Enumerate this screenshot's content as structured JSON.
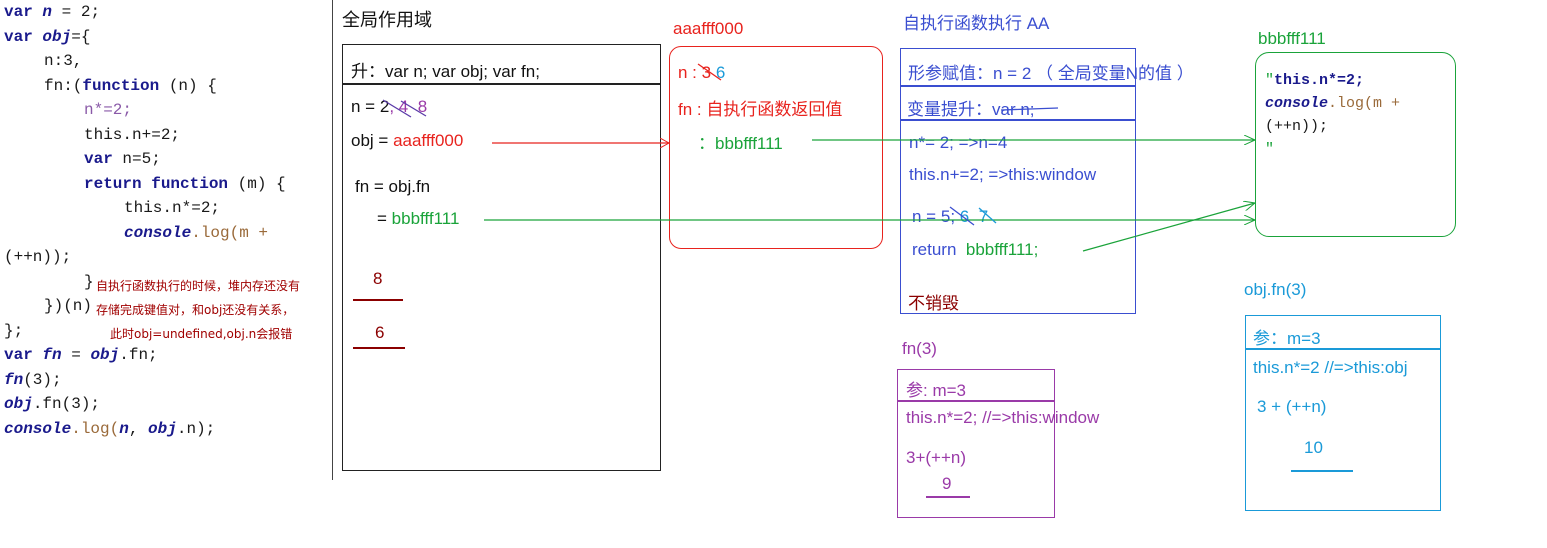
{
  "code": {
    "l1_kw": "var",
    "l1_var": "n",
    "l1_rest": " = 2;",
    "l2_kw": "var",
    "l2_var": "obj",
    "l2_rest": "={",
    "l3": "n:3,",
    "l4_a": "fn:(",
    "l4_kw": "function",
    "l4_b": " (n) {",
    "l5": "n*=2;",
    "l6": "this.n+=2;",
    "l7_kw": "var",
    "l7_rest": " n=5;",
    "l8_kw1": "return",
    "l8_kw2": "function",
    "l8_rest": " (m) {",
    "l9": "this.n*=2;",
    "l10_obj": "console",
    "l10_rest": ".log(m +",
    "l11": "(++n));",
    "l12": "}",
    "l13": "})(n)",
    "l14": "};",
    "l15_kw": "var",
    "l15_var": "fn",
    "l15_eq": " = ",
    "l15_obj": "obj",
    "l15_rest": ".fn;",
    "l16_fn": "fn",
    "l16_rest": "(3);",
    "l17_obj": "obj",
    "l17_rest": ".fn(3);",
    "l18_obj": "console",
    "l18_a": ".log(",
    "l18_n": "n",
    "l18_b": ",  ",
    "l18_obj2": "obj",
    "l18_c": ".n);"
  },
  "note": {
    "line1": "自执行函数执行的时候，堆内存还没有",
    "line2": "存储完成键值对，和obj还没有关系，",
    "line3": "此时obj=undefined,obj.n会报错"
  },
  "global": {
    "title": "全局作用域",
    "hoist": "升：var n;  var obj;  var fn;",
    "n_label": "n = ",
    "n_v1": "2",
    "n_v2": "4",
    "n_v3": "8",
    "obj_label": "obj = ",
    "obj_value": "aaafff000",
    "fn_label": "fn = obj.fn",
    "fn_eq": "= ",
    "fn_value": "bbbfff111",
    "out1": "8",
    "out2": "6"
  },
  "heap_aaa": {
    "address": "aaafff000",
    "n_label": "n : ",
    "n_old": "3",
    "n_new": "6",
    "fn_label": "fn : 自执行函数返回值",
    "fn_colon": "：",
    "fn_value": "bbbfff111"
  },
  "scope_aa": {
    "title": "自执行函数执行 AA",
    "param": "形参赋值：n = 2 （ 全局变量N的值 ）",
    "hoist": "变量提升：var n;",
    "l1": "n*= 2;  =>n=4",
    "l2": "this.n+=2;  =>this:window",
    "l3_a": "n = ",
    "l3_v1": "5",
    "l3_semi": "; ",
    "l3_v2": "6",
    "l3_v3": "7",
    "ret_kw": "return",
    "ret_val": "bbbfff111;",
    "keep": "不销毁"
  },
  "heap_bbb": {
    "address": "bbbfff111",
    "l1_q": "\"",
    "l1": "this.n*=2;",
    "l2_obj": "console",
    "l2_rest": ".log(m +",
    "l3": "(++n));",
    "l4": "\""
  },
  "call_fn3": {
    "title": "fn(3)",
    "param": "参: m=3",
    "l1": "this.n*=2; //=>this:window",
    "l2": "3+(++n)",
    "result": "9"
  },
  "call_objfn3": {
    "title": "obj.fn(3)",
    "param": "参：m=3",
    "l1": "this.n*=2 //=>this:obj",
    "l2": "3 + (++n)",
    "result": "10"
  },
  "colors": {
    "red": "#e8231e",
    "green": "#1aa33a",
    "blue": "#3a4ed0",
    "cyan": "#1a9ad8",
    "purple": "#9a3aa8",
    "darkred": "#8b0000"
  }
}
